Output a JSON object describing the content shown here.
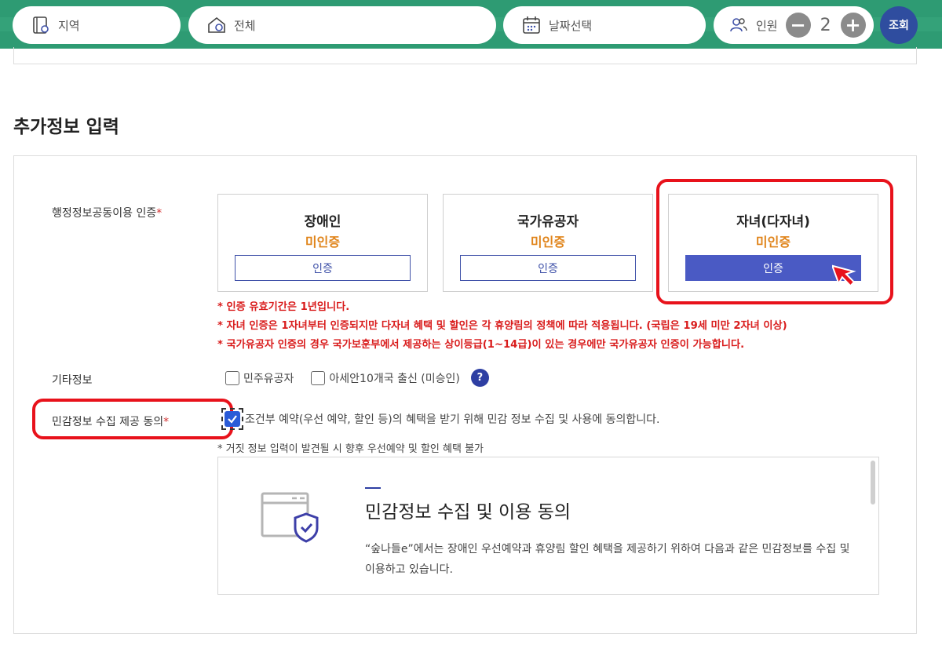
{
  "search_bar": {
    "region_placeholder": "지역",
    "category_placeholder": "전체",
    "date_placeholder": "날짜선택",
    "people_label": "인원",
    "people_count": "2",
    "minus": "−",
    "plus": "+",
    "search_label": "조회"
  },
  "section": {
    "title": "추가정보 입력"
  },
  "admin_cert": {
    "label": "행정정보공동이용 인증",
    "required_mark": "*",
    "cards": [
      {
        "title": "장애인",
        "status": "미인증",
        "button": "인증"
      },
      {
        "title": "국가유공자",
        "status": "미인증",
        "button": "인증"
      },
      {
        "title": "자녀(다자녀)",
        "status": "미인증",
        "button": "인증"
      }
    ],
    "notes": [
      "* 인증 유효기간은 1년입니다.",
      "* 자녀 인증은 1자녀부터 인증되지만 다자녀 혜택 및 할인은 각 휴양림의 정책에 따라 적용됩니다. (국립은 19세 미만 2자녀 이상)",
      "* 국가유공자 인증의 경우 국가보훈부에서 제공하는 상이등급(1~14급)이 있는 경우에만 국가유공자 인증이 가능합니다."
    ]
  },
  "etc_info": {
    "label": "기타정보",
    "options": [
      "민주유공자",
      "아세안10개국 출신 (미승인)"
    ],
    "help": "?"
  },
  "sensitive_consent": {
    "label": "민감정보 수집 제공 동의",
    "required_mark": "*",
    "checkbox_text": "조건부 예약(우선 예약, 할인 등)의 혜택을 받기 위해 민감 정보 수집 및 사용에 동의합니다.",
    "note": "* 거짓 정보 입력이 발견될 시 향후 우선예약 및 할인 혜택 불가",
    "terms_title": "민감정보 수집 및 이용 동의",
    "terms_body": "“숲나들e”에서는 장애인 우선예약과 휴양림 할인 혜택을 제공하기 위하여 다음과 같은 민감정보를 수집 및 이용하고 있습니다."
  },
  "colors": {
    "brand_green": "#2e9b73",
    "accent_blue": "#2f4d9f",
    "status_orange": "#e0841a",
    "notice_red": "#d91c1c",
    "highlight_red": "#e8121b"
  }
}
